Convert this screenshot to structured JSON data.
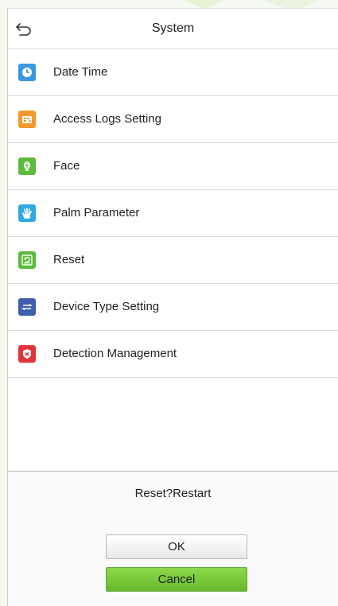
{
  "header": {
    "title": "System",
    "back_icon": "back-arrow-icon"
  },
  "menu": {
    "items": [
      {
        "label": "Date Time",
        "icon": "clock-icon",
        "color": "#3a97dd"
      },
      {
        "label": "Access Logs Setting",
        "icon": "log-icon",
        "color": "#f29a2e"
      },
      {
        "label": "Face",
        "icon": "face-icon",
        "color": "#5bbb3a"
      },
      {
        "label": "Palm Parameter",
        "icon": "palm-icon",
        "color": "#2fa9e0"
      },
      {
        "label": "Reset",
        "icon": "reset-icon",
        "color": "#5bbb3a"
      },
      {
        "label": "Device Type Setting",
        "icon": "swap-icon",
        "color": "#3f5fae"
      },
      {
        "label": "Detection Management",
        "icon": "shield-icon",
        "color": "#e2353a"
      }
    ]
  },
  "dialog": {
    "message": "Reset?Restart",
    "ok_label": "OK",
    "cancel_label": "Cancel"
  }
}
